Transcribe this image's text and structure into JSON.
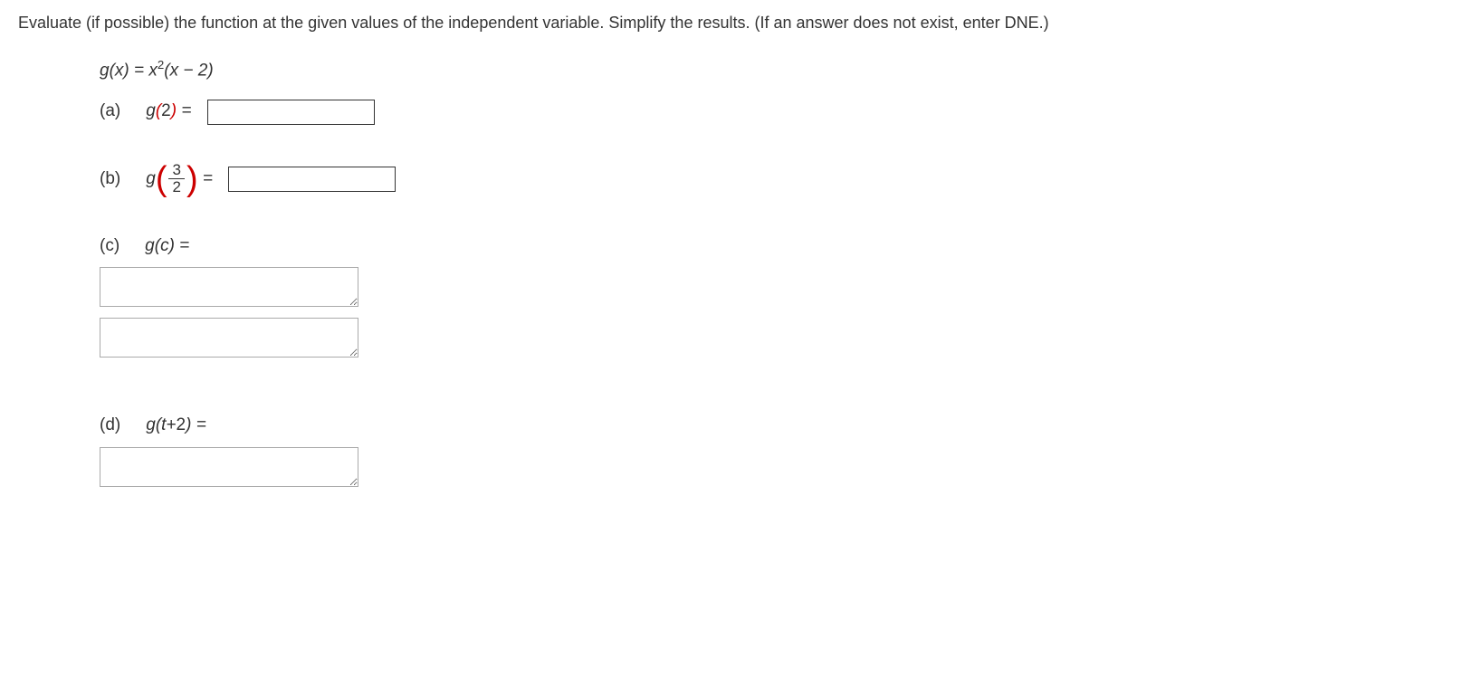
{
  "instructions": "Evaluate (if possible) the function at the given values of the independent variable. Simplify the results. (If an answer does not exist, enter DNE.)",
  "function": {
    "name": "g",
    "variable": "x",
    "constant": "2",
    "exponent": "2"
  },
  "parts": {
    "a": {
      "label": "(a)",
      "arg": "2"
    },
    "b": {
      "label": "(b)",
      "frac_num": "3",
      "frac_den": "2"
    },
    "c": {
      "label": "(c)",
      "arg": "c"
    },
    "d": {
      "label": "(d)",
      "arg_var": "t",
      "arg_const": "2"
    }
  }
}
